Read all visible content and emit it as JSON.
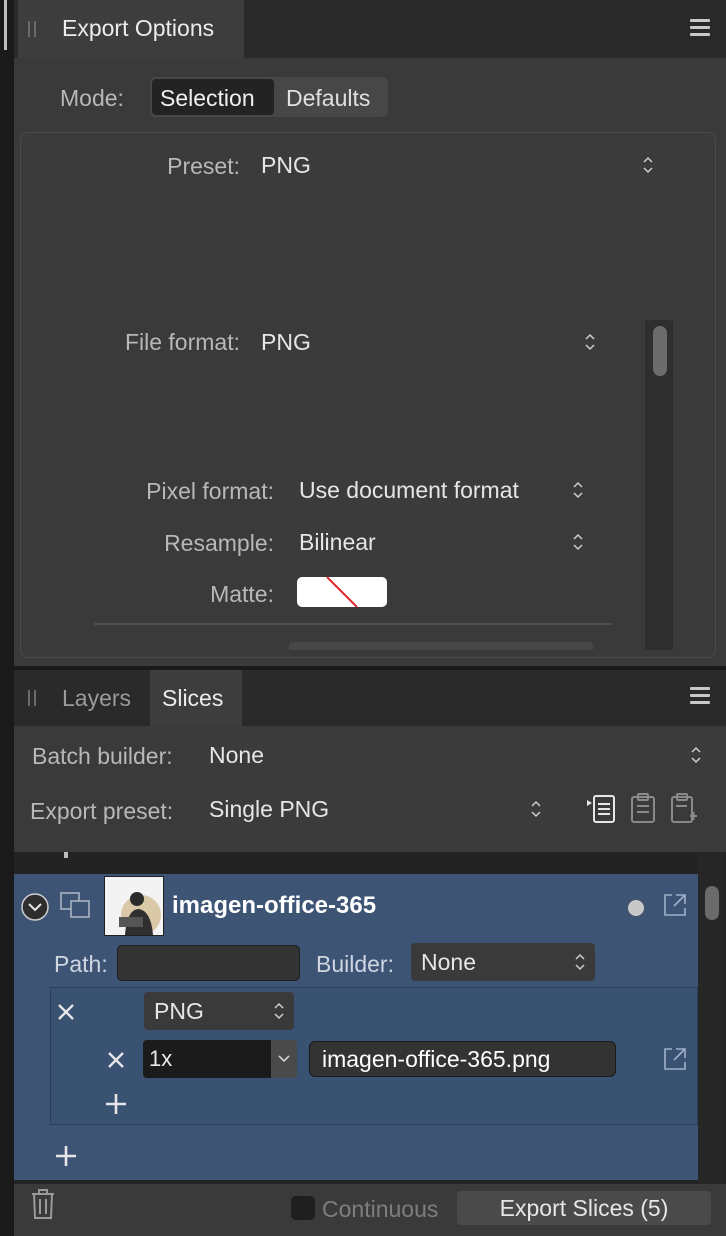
{
  "export_options": {
    "title": "Export Options",
    "mode_label": "Mode:",
    "mode_tabs": [
      "Selection",
      "Defaults"
    ],
    "preset_label": "Preset:",
    "preset_value": "PNG",
    "file_format_label": "File format:",
    "file_format_value": "PNG",
    "pixel_format_label": "Pixel format:",
    "pixel_format_value": "Use document format",
    "resample_label": "Resample:",
    "resample_value": "Bilinear",
    "matte_label": "Matte:"
  },
  "bottom_panel": {
    "tabs": [
      "Layers",
      "Slices"
    ],
    "batch_builder_label": "Batch builder:",
    "batch_builder_value": "None",
    "export_preset_label": "Export preset:",
    "export_preset_value": "Single PNG"
  },
  "slice": {
    "name": "imagen-office-365",
    "path_label": "Path:",
    "path_value": "",
    "builder_label": "Builder:",
    "builder_value": "None",
    "format_value": "PNG",
    "scale_value": "1x",
    "filename": "imagen-office-365.png"
  },
  "footer": {
    "continuous_label": "Continuous",
    "export_button": "Export Slices (5)"
  },
  "colors": {
    "selection_bg": "#3d5475",
    "accent_red": "#e0262a"
  }
}
